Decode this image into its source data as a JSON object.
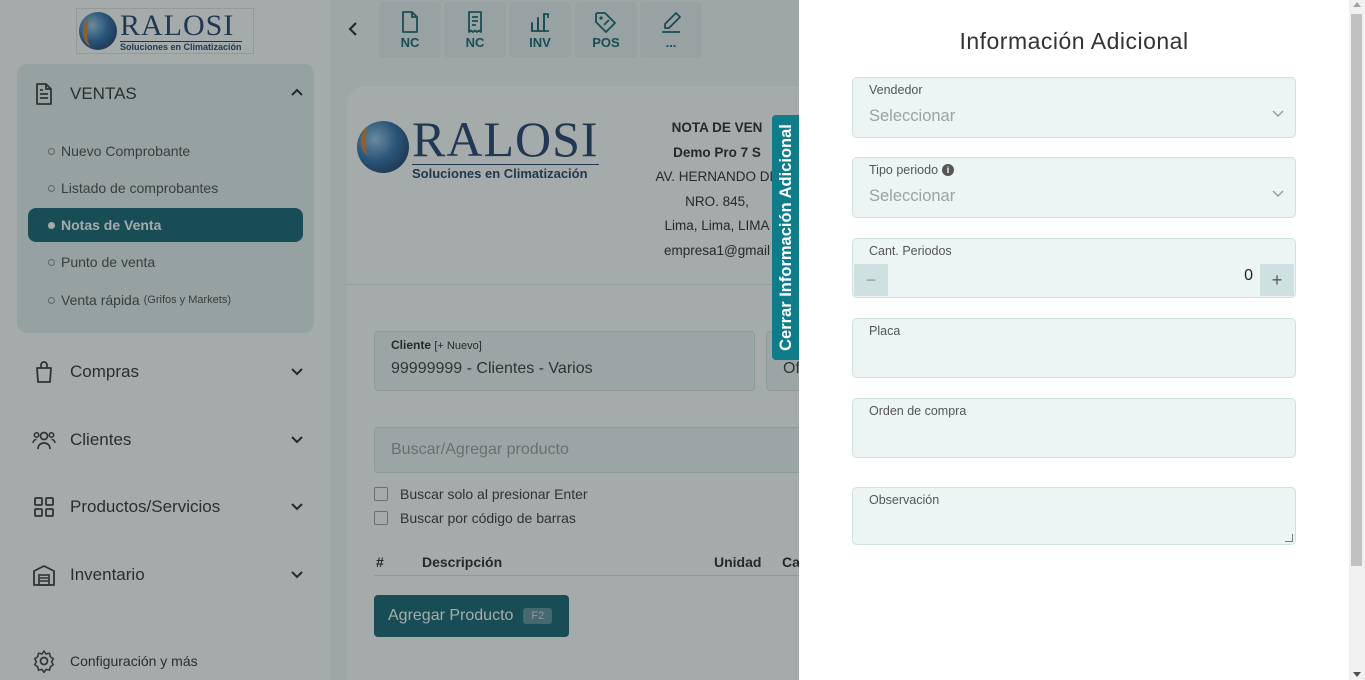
{
  "brand": {
    "logo_word": "RALOSI",
    "logo_sub": "Soluciones en Climatización"
  },
  "sidebar": {
    "ventas_label": "VENTAS",
    "ventas_items": [
      {
        "label": "Nuevo Comprobante",
        "extra": ""
      },
      {
        "label": "Listado de comprobantes",
        "extra": ""
      },
      {
        "label": "Notas de Venta",
        "extra": ""
      },
      {
        "label": "Punto de venta",
        "extra": ""
      },
      {
        "label": "Venta rápida",
        "extra": "(Grifos y Markets)"
      }
    ],
    "nav_items": [
      {
        "label": "Compras",
        "icon": "bag-icon"
      },
      {
        "label": "Clientes",
        "icon": "users-icon"
      },
      {
        "label": "Productos/Servicios",
        "icon": "grid-icon"
      },
      {
        "label": "Inventario",
        "icon": "warehouse-icon"
      }
    ],
    "settings_label": "Configuración y más",
    "active_color": "#0f5d6b"
  },
  "toolbar": {
    "buttons": [
      {
        "label": "NC",
        "icon": "document-icon"
      },
      {
        "label": "NC",
        "icon": "receipt-icon"
      },
      {
        "label": "INV",
        "icon": "inventory-icon"
      },
      {
        "label": "POS",
        "icon": "tag-icon"
      },
      {
        "label": "...",
        "icon": "edit-icon"
      }
    ]
  },
  "document": {
    "type_title": "NOTA DE VEN",
    "company_name": "Demo Pro 7 S",
    "address_line1": "AV. HERNANDO DE",
    "address_line2": "NRO. 845,",
    "address_line3": "Lima, Lima, LIMA",
    "email": "empresa1@gmail"
  },
  "form": {
    "client_label": "Cliente",
    "client_add": "[+ Nuevo]",
    "client_value": "99999999 - Clientes - Varios",
    "client2_value": "Of",
    "search_placeholder": "Buscar/Agregar producto",
    "check_enter": "Buscar solo al presionar Enter",
    "check_barcode": "Buscar por código de barras",
    "table_cols": [
      "#",
      "Descripción",
      "Unidad",
      "Ca"
    ],
    "add_product_label": "Agregar Producto",
    "add_product_key": "F2"
  },
  "toggle_tab": {
    "label": "Cerrar Información Adicional"
  },
  "drawer": {
    "title": "Información Adicional",
    "vendedor_label": "Vendedor",
    "vendedor_value": "Seleccionar",
    "tipo_periodo_label": "Tipo periodo",
    "tipo_periodo_value": "Seleccionar",
    "cant_periodos_label": "Cant. Periodos",
    "cant_periodos_value": "0",
    "placa_label": "Placa",
    "placa_value": "",
    "orden_label": "Orden de compra",
    "orden_value": "",
    "observacion_label": "Observación",
    "observacion_value": ""
  }
}
